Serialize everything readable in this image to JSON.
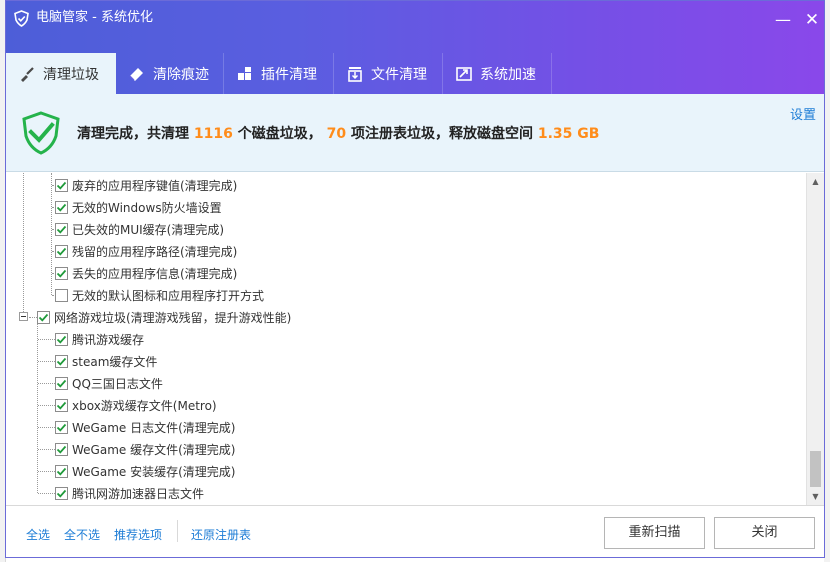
{
  "window": {
    "title": "电脑管家 - 系统优化",
    "minimize_label": "—",
    "close_label": "✕"
  },
  "tabs": [
    {
      "label": "清理垃圾",
      "icon": "broom-icon",
      "active": true
    },
    {
      "label": "清除痕迹",
      "icon": "eraser-icon",
      "active": false
    },
    {
      "label": "插件清理",
      "icon": "puzzle-icon",
      "active": false
    },
    {
      "label": "文件清理",
      "icon": "file-download-icon",
      "active": false
    },
    {
      "label": "系统加速",
      "icon": "rocket-icon",
      "active": false
    }
  ],
  "summary": {
    "prefix": "清理完成，共清理 ",
    "disk_count": "1116",
    "mid1": " 个磁盘垃圾， ",
    "registry_count": "70",
    "mid2": " 项注册表垃圾，释放磁盘空间 ",
    "freed": "1.35 GB",
    "settings_label": "设置"
  },
  "tree": {
    "group1_items": [
      {
        "label": "废弃的应用程序键值(清理完成)",
        "checked": true
      },
      {
        "label": "无效的Windows防火墙设置",
        "checked": true
      },
      {
        "label": "已失效的MUI缓存(清理完成)",
        "checked": true
      },
      {
        "label": "残留的应用程序路径(清理完成)",
        "checked": true
      },
      {
        "label": "丢失的应用程序信息(清理完成)",
        "checked": true
      },
      {
        "label": "无效的默认图标和应用程序打开方式",
        "checked": false
      }
    ],
    "group2": {
      "label": "网络游戏垃圾(清理游戏残留，提升游戏性能)",
      "checked": true
    },
    "group2_items": [
      {
        "label": "腾讯游戏缓存",
        "checked": true
      },
      {
        "label": "steam缓存文件",
        "checked": true
      },
      {
        "label": "QQ三国日志文件",
        "checked": true
      },
      {
        "label": "xbox游戏缓存文件(Metro)",
        "checked": true
      },
      {
        "label": "WeGame 日志文件(清理完成)",
        "checked": true
      },
      {
        "label": "WeGame 缓存文件(清理完成)",
        "checked": true
      },
      {
        "label": "WeGame 安装缓存(清理完成)",
        "checked": true
      },
      {
        "label": "腾讯网游加速器日志文件",
        "checked": true
      }
    ]
  },
  "footer": {
    "select_all": "全选",
    "select_none": "全不选",
    "recommended": "推荐选项",
    "restore_registry": "还原注册表",
    "rescan": "重新扫描",
    "close": "关闭"
  },
  "colors": {
    "accent_blue": "#1e7dd6",
    "highlight_orange": "#ff8c1a",
    "title_gradient_start": "#4d5ed8",
    "title_gradient_end": "#8a48ea",
    "shield_green": "#25b34b"
  }
}
